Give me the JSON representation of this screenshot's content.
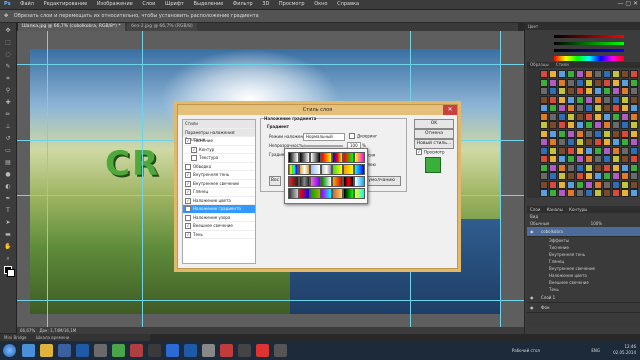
{
  "menu": {
    "items": [
      "Файл",
      "Редактирование",
      "Изображение",
      "Слои",
      "Шрифт",
      "Выделение",
      "Фильтр",
      "3D",
      "Просмотр",
      "Окно",
      "Справка"
    ],
    "window_controls": "—  ▢  ✕"
  },
  "options_bar": {
    "text": "Обрезать слои и перемещать их относительно, чтобы установить расположение градиента"
  },
  "tabs": [
    {
      "label": "Шапка.jpg @ 66,7% (cobolkobra, RGB/8*) *",
      "active": true
    },
    {
      "label": "без-2.jpg @ 66,7% (RGB/8)",
      "active": false
    }
  ],
  "status": {
    "zoom": "66,67%",
    "doc": "Док: 1,74М/16,1М"
  },
  "mini_bridge_tabs": [
    "Mini Bridge",
    "Шкала времени"
  ],
  "canvas": {
    "logo_text": "CR"
  },
  "dialog": {
    "title": "Стиль слоя",
    "close_glyph": "✕",
    "style_list": [
      {
        "label": "Стили",
        "checked": null,
        "header": true,
        "selected": false
      },
      {
        "label": "Параметры наложения: Заказные",
        "checked": null,
        "header": true,
        "selected": false
      },
      {
        "label": "Тиснение",
        "checked": true,
        "header": false,
        "selected": false
      },
      {
        "label": "Контур",
        "checked": true,
        "header": false,
        "selected": false,
        "indent": true
      },
      {
        "label": "Текстура",
        "checked": false,
        "header": false,
        "selected": false,
        "indent": true
      },
      {
        "label": "Обводка",
        "checked": false,
        "header": false,
        "selected": false
      },
      {
        "label": "Внутренняя тень",
        "checked": true,
        "header": false,
        "selected": false
      },
      {
        "label": "Внутреннее свечение",
        "checked": true,
        "header": false,
        "selected": false
      },
      {
        "label": "Глянец",
        "checked": true,
        "header": false,
        "selected": false
      },
      {
        "label": "Наложение цвета",
        "checked": true,
        "header": false,
        "selected": false
      },
      {
        "label": "Наложение градиента",
        "checked": true,
        "header": false,
        "selected": true
      },
      {
        "label": "Наложение узора",
        "checked": false,
        "header": false,
        "selected": false
      },
      {
        "label": "Внешнее свечение",
        "checked": true,
        "header": false,
        "selected": false
      },
      {
        "label": "Тень",
        "checked": true,
        "header": false,
        "selected": false
      }
    ],
    "group_title": "Наложение градиента",
    "group_sub": "Градиент",
    "blend_label": "Режим наложения:",
    "blend_value": "Нормальный",
    "dither_label": "Дизеринг",
    "opacity_label": "Непрозрачность:",
    "opacity_value": "100",
    "opacity_unit": "%",
    "gradient_label": "Градиент:",
    "reverse_label": "Инверсия",
    "align_text": "ть по слою",
    "default_btn": "Вос",
    "reset_btn": "ию по умолчанию",
    "buttons": {
      "ok": "OK",
      "cancel": "Отмена",
      "new_style": "Новый стиль...",
      "preview": "Просмотр"
    }
  },
  "layers_panel": {
    "tabs": [
      "Слои",
      "Каналы",
      "Контуры"
    ],
    "filter_label": "Вид",
    "blend": "Обычные",
    "opacity": "100%",
    "layers": [
      {
        "name": "cobolkobra",
        "selected": true,
        "kind": "layer"
      },
      {
        "name": "Эффекты",
        "selected": false,
        "kind": "fx"
      },
      {
        "name": "Тиснение",
        "selected": false,
        "kind": "fx"
      },
      {
        "name": "Внутренняя тень",
        "selected": false,
        "kind": "fx"
      },
      {
        "name": "Глянец",
        "selected": false,
        "kind": "fx"
      },
      {
        "name": "Внутреннее свечение",
        "selected": false,
        "kind": "fx"
      },
      {
        "name": "Наложение цвета",
        "selected": false,
        "kind": "fx"
      },
      {
        "name": "Внешнее свечение",
        "selected": false,
        "kind": "fx"
      },
      {
        "name": "Тень",
        "selected": false,
        "kind": "fx"
      },
      {
        "name": "Слой 1",
        "selected": false,
        "kind": "layer"
      },
      {
        "name": "Фон",
        "selected": false,
        "kind": "layer"
      }
    ]
  },
  "right_panels": {
    "color_title": "Цвет",
    "swatches_title": "Образцы",
    "styles_title": "Стили"
  },
  "taskbar": {
    "lang": "ENG",
    "time": "12:46",
    "date": "02.05.2014",
    "desktop_label": "Рабочий стол"
  },
  "colors": {
    "accent_selection": "#3399ff",
    "guide": "#6fd4e8",
    "dialog_border": "#e2b86a",
    "preview_green": "#3cae3c"
  }
}
